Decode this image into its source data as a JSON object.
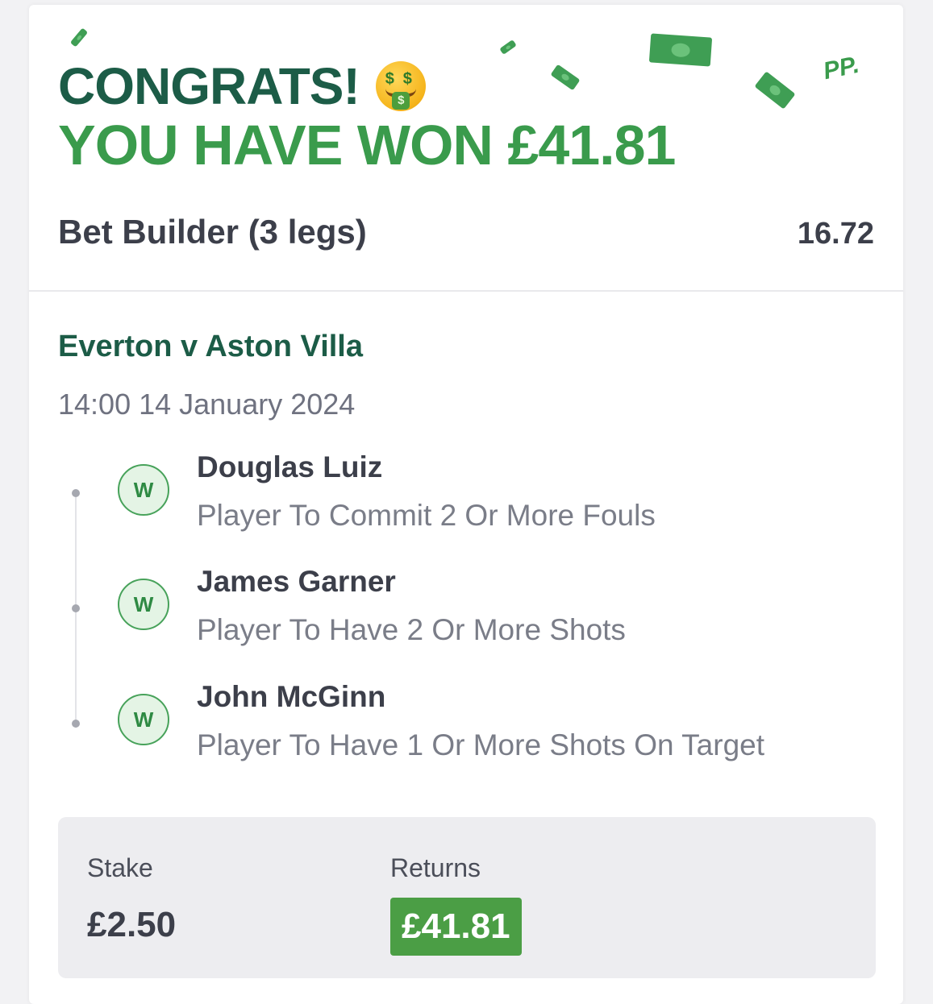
{
  "header": {
    "congrats": "CONGRATS!",
    "won_text": "YOU HAVE WON £41.81",
    "logo": "PP.",
    "emoji_icon": "money-mouth-face-icon",
    "confetti_icon": "banknote-icon"
  },
  "bet": {
    "title": "Bet Builder (3 legs)",
    "odds": "16.72"
  },
  "event": {
    "title": "Everton v Aston Villa",
    "datetime": "14:00 14 January 2024"
  },
  "legs": [
    {
      "status": "W",
      "player": "Douglas Luiz",
      "market": "Player To Commit 2 Or More Fouls"
    },
    {
      "status": "W",
      "player": "James Garner",
      "market": "Player To Have 2 Or More Shots"
    },
    {
      "status": "W",
      "player": "John McGinn",
      "market": "Player To Have 1 Or More Shots On Target"
    }
  ],
  "summary": {
    "stake_label": "Stake",
    "stake_value": "£2.50",
    "returns_label": "Returns",
    "returns_value": "£41.81"
  },
  "colors": {
    "brand_dark_green": "#1c5c47",
    "brand_green": "#3a9b4c",
    "win_badge": "#47a25a",
    "returns_bg": "#4b9e45"
  }
}
